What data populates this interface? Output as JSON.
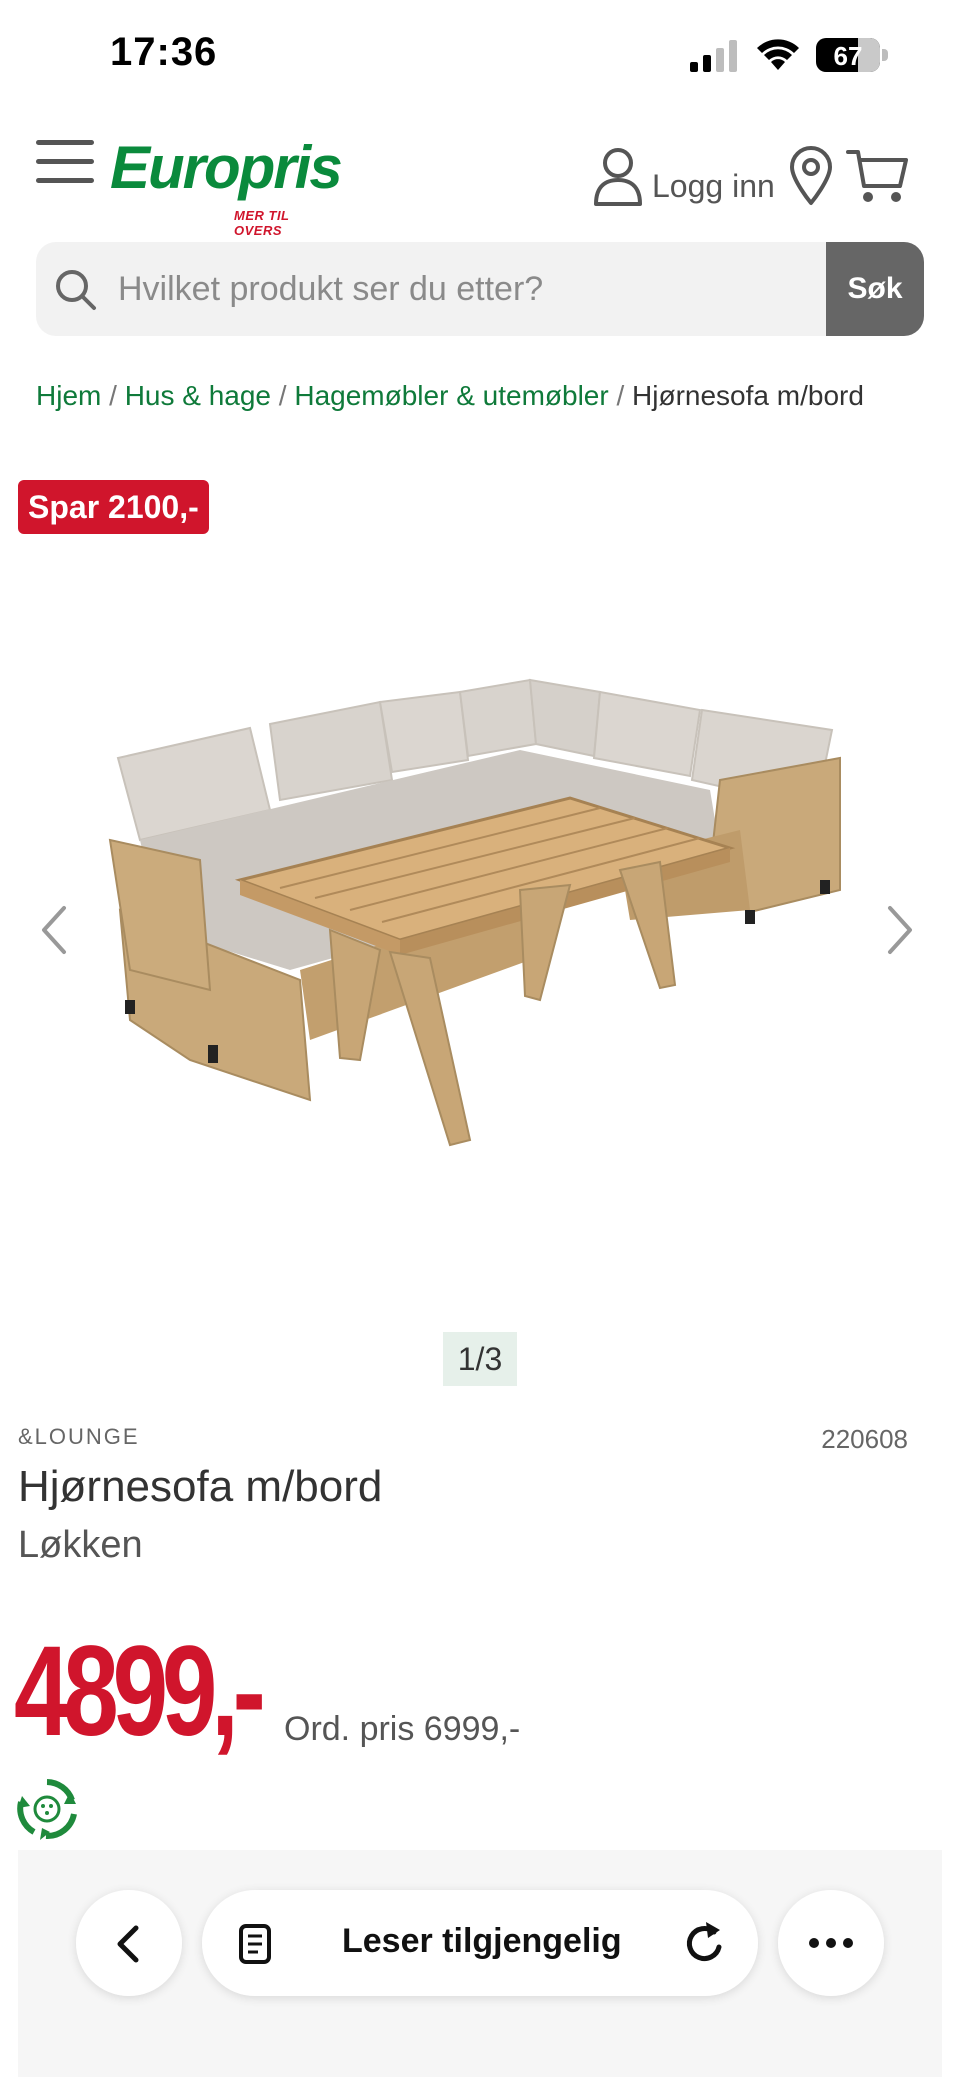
{
  "status_bar": {
    "time": "17:36",
    "battery": "67"
  },
  "header": {
    "logo_text": "Europris",
    "logo_tagline": "MER TIL OVERS",
    "login_label": "Logg inn"
  },
  "search": {
    "placeholder": "Hvilket produkt ser du etter?",
    "button_label": "Søk"
  },
  "breadcrumb": {
    "items": [
      "Hjem",
      "Hus & hage",
      "Hagemøbler & utemøbler"
    ],
    "separator": "/",
    "current": "Hjørnesofa m/bord"
  },
  "product": {
    "save_badge": "Spar 2100,-",
    "image_counter": "1/3",
    "brand": "&LOUNGE",
    "sku": "220608",
    "title": "Hjørnesofa m/bord",
    "subtitle": "Løkken",
    "price": "4899,-",
    "ord_price": "Ord. pris 6999,-"
  },
  "bottom_toolbar": {
    "reader_label": "Leser tilgjengelig"
  },
  "colors": {
    "brand_green": "#0a8a3c",
    "accent_red": "#d0152c",
    "search_button": "#666666"
  }
}
